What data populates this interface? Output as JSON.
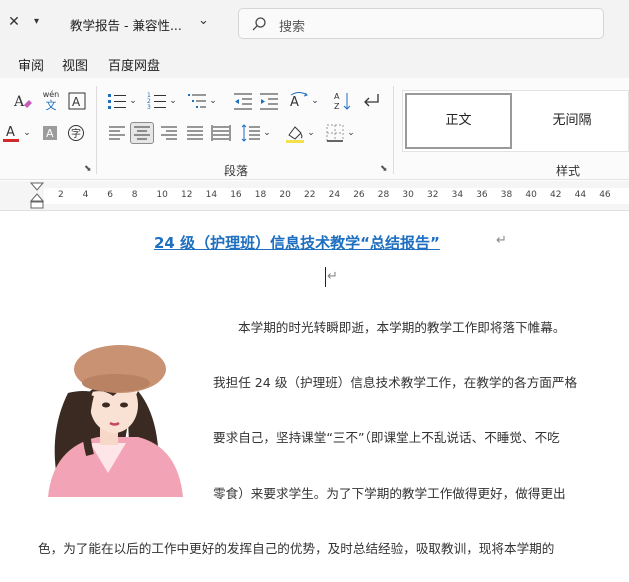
{
  "titlebar": {
    "doc_title": "教学报告  -  兼容性...",
    "search_placeholder": "搜索"
  },
  "menu": {
    "tabs": [
      "审阅",
      "视图",
      "百度网盘"
    ]
  },
  "ribbon": {
    "pinyin_label": "wén",
    "pinyin_char": "文",
    "paragraph_group": "段落",
    "styles_group": "样式",
    "styles": [
      "正文",
      "无间隔"
    ],
    "accent_red": "#d22a2a"
  },
  "ruler": {
    "numbers": [
      "2",
      "4",
      "6",
      "8",
      "10",
      "12",
      "14",
      "16",
      "18",
      "20",
      "22",
      "24",
      "26",
      "28",
      "30",
      "32",
      "34",
      "36",
      "38",
      "40",
      "42",
      "44",
      "46"
    ]
  },
  "document": {
    "title": "24 级（护理班）信息技术教学“总结报告”",
    "title_color": "#1e6fc0",
    "lines": [
      "本学期的时光转瞬即逝，本学期的教学工作即将落下帷幕。",
      "我担任 24 级（护理班）信息技术教学工作，在教学的各方面严格",
      "要求自己，坚持课堂“三不”（即课堂上不乱说话、不睡觉、不吃",
      "零食）来要求学生。为了下学期的教学工作做得更好，做得更出",
      "色，为了能在以后的工作中更好的发挥自己的优势，及时总结经验，吸取教训，现将本学期的"
    ],
    "para_mark": "↵"
  }
}
